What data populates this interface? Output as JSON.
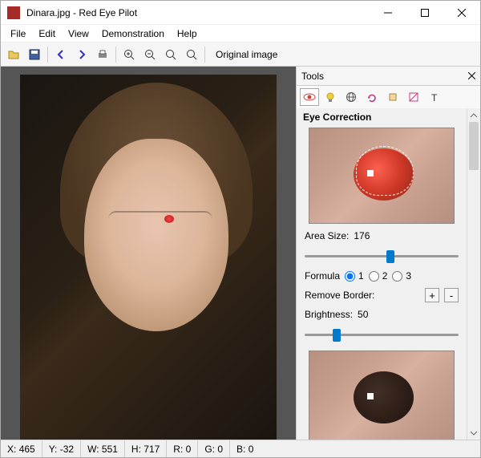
{
  "titlebar": {
    "title": "Dinara.jpg - Red Eye Pilot"
  },
  "menubar": {
    "file": "File",
    "edit": "Edit",
    "view": "View",
    "demo": "Demonstration",
    "help": "Help"
  },
  "toolbar": {
    "original": "Original image"
  },
  "panel": {
    "title": "Tools",
    "section": "Eye Correction",
    "area_label": "Area Size:",
    "area_value": "176",
    "formula_label": "Formula",
    "formula_1": "1",
    "formula_2": "2",
    "formula_3": "3",
    "remove_border": "Remove Border:",
    "brightness_label": "Brightness:",
    "brightness_value": "50",
    "plus": "+",
    "minus": "-"
  },
  "statusbar": {
    "x_label": "X:",
    "x_val": "465",
    "y_label": "Y:",
    "y_val": "-32",
    "w_label": "W:",
    "w_val": "551",
    "h_label": "H:",
    "h_val": "717",
    "r_label": "R:",
    "r_val": "0",
    "g_label": "G:",
    "g_val": "0",
    "b_label": "B:",
    "b_val": "0"
  },
  "sliders": {
    "area_pos_pct": 53,
    "brightness_pos_pct": 18
  }
}
